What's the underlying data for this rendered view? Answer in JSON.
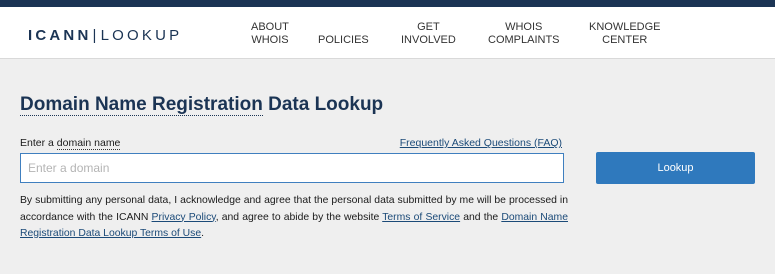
{
  "header": {
    "logo": {
      "primary": "ICANN",
      "separator": "|",
      "secondary": "LOOKUP"
    },
    "nav": [
      {
        "label": "ABOUT\nWHOIS"
      },
      {
        "label": "POLICIES"
      },
      {
        "label": "GET\nINVOLVED"
      },
      {
        "label": "WHOIS\nCOMPLAINTS"
      },
      {
        "label": "KNOWLEDGE\nCENTER"
      }
    ]
  },
  "main": {
    "title_part1": "Domain Name Registration",
    "title_part2": " Data Lookup",
    "field_label_prefix": "Enter a ",
    "field_label_dotted": "domain name",
    "faq_link": "Frequently Asked Questions (FAQ)",
    "input_placeholder": "Enter a domain",
    "input_value": "",
    "lookup_button": "Lookup",
    "consent": {
      "text1": "By submitting any personal data, I acknowledge and agree that the personal data submitted by me will be processed in accordance with the ICANN ",
      "link1": "Privacy Policy",
      "text2": ", and agree to abide by the website ",
      "link2": "Terms of Service",
      "text3": " and the ",
      "link3": "Domain Name Registration Data Lookup Terms of Use",
      "text4": "."
    }
  },
  "colors": {
    "brand_navy": "#1b3454",
    "button_blue": "#2f79bd",
    "page_background": "#efefef"
  }
}
